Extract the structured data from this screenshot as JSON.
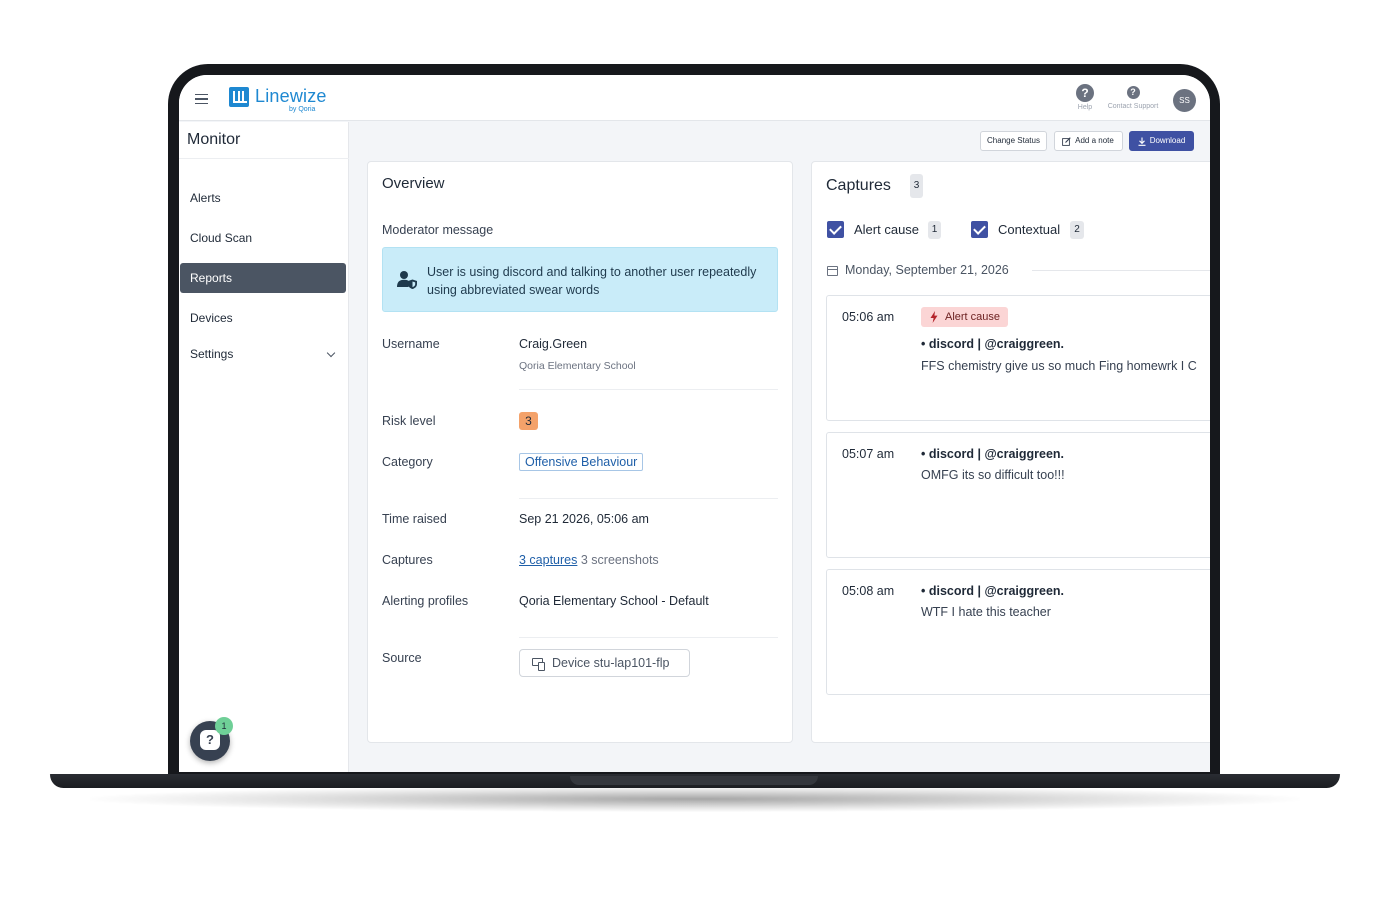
{
  "app": {
    "brand": "Linewize",
    "brand_sub": "by Qoria",
    "help_label": "Help",
    "help_glyph": "?",
    "support_label": "Contact Support",
    "support_glyph": "?",
    "avatar_initials": "SS"
  },
  "sidebar": {
    "title": "Monitor",
    "items": [
      {
        "label": "Alerts"
      },
      {
        "label": "Cloud Scan"
      },
      {
        "label": "Reports"
      },
      {
        "label": "Devices"
      },
      {
        "label": "Settings"
      }
    ],
    "active_item": "Reports",
    "chat_glyph": "?",
    "chat_badge": "1"
  },
  "actions": {
    "change_status": "Change Status",
    "add_note": "Add a note",
    "download": "Download"
  },
  "overview": {
    "title": "Overview",
    "moderator_label": "Moderator message",
    "moderator_message": "User is using discord and talking to another user repeatedly using abbreviated swear words",
    "username_label": "Username",
    "username": "Craig.Green",
    "school": "Qoria Elementary School",
    "risk_label": "Risk level",
    "risk_value": "3",
    "category_label": "Category",
    "category_value": "Offensive Behaviour",
    "time_label": "Time raised",
    "time_value": "Sep 21 2026, 05:06 am",
    "captures_label": "Captures",
    "captures_link": "3 captures",
    "captures_extra": "3 screenshots",
    "profiles_label": "Alerting profiles",
    "profiles_value": "Qoria Elementary School - Default",
    "source_label": "Source",
    "source_value": "Device stu-lap101-flp"
  },
  "captures": {
    "title": "Captures",
    "count": "3",
    "filters": [
      {
        "label": "Alert cause",
        "count": "1",
        "checked": true
      },
      {
        "label": "Contextual",
        "count": "2",
        "checked": true
      }
    ],
    "date": "Monday, September 21, 2026",
    "alert_tag": "Alert cause",
    "items": [
      {
        "time": "05:06 am",
        "source": "• discord | @craiggreen.",
        "message": "FFS chemistry give us so much Fing homewrk I C"
      },
      {
        "time": "05:07 am",
        "source": "• discord | @craiggreen.",
        "message": "OMFG its so difficult too!!!"
      },
      {
        "time": "05:08 am",
        "source": "• discord | @craiggreen.",
        "message": "WTF I hate this teacher"
      }
    ]
  },
  "colors": {
    "accent": "#3f51a3",
    "brand": "#1e88d1",
    "info_box": "#c9ecf9",
    "risk": "#f4a26a",
    "alert_tag": "#fbd5d5"
  }
}
